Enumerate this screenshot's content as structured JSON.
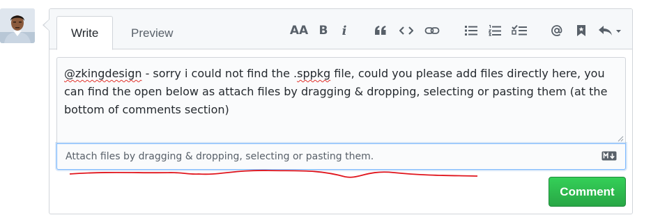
{
  "tabs": {
    "write": "Write",
    "preview": "Preview"
  },
  "toolbar": {
    "text_size": "AA",
    "bold": "B",
    "italic": "i",
    "icons": [
      "text-size-icon",
      "bold-icon",
      "italic-icon",
      "quote-icon",
      "code-icon",
      "link-icon",
      "bulleted-list-icon",
      "numbered-list-icon",
      "task-list-icon",
      "mention-icon",
      "bookmark-icon",
      "reply-icon"
    ]
  },
  "comment": {
    "mention": "@zkingdesign",
    "text_before_pkg": "  - sorry i could not find the .",
    "pkg": "sppkg",
    "text_after_pkg": " file, could you please add files directly here, you can find the open below as attach files by dragging & dropping, selecting or pasting them (at the bottom of comments section)"
  },
  "attach": {
    "placeholder": "Attach files by dragging & dropping, selecting or pasting them."
  },
  "submit": {
    "label": "Comment"
  },
  "colors": {
    "accent_green": "#28a745",
    "focus_blue": "#79b8ff",
    "annotation_red": "#e0141c",
    "icon_gray": "#586069"
  }
}
